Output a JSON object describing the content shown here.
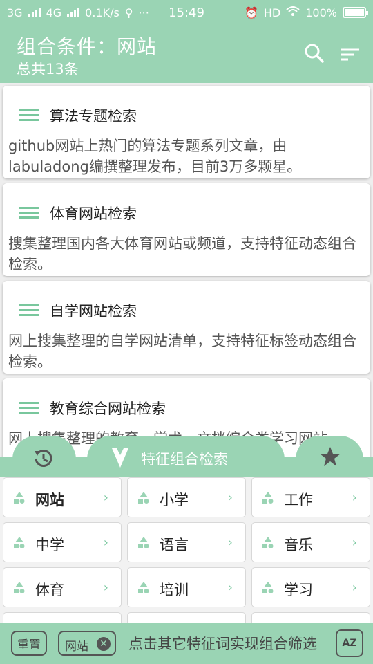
{
  "status_bar": {
    "net1": "3G",
    "net2": "4G",
    "speed": "0.1K/s",
    "time": "15:49",
    "hd": "HD",
    "battery": "100%"
  },
  "header": {
    "title": "组合条件：网站",
    "subtitle": "总共13条"
  },
  "cards": [
    {
      "title": "算法专题检索",
      "desc": "github网站上热门的算法专题系列文章，由labuladong编撰整理发布，目前3万多颗星。"
    },
    {
      "title": "体育网站检索",
      "desc": "搜集整理国内各大体育网站或频道，支持特征动态组合检索。"
    },
    {
      "title": "自学网站检索",
      "desc": "网上搜集整理的自学网站清单，支持特征标签动态组合检索。"
    },
    {
      "title": "教育综合网站检索",
      "desc": "网上搜集整理的教育、学术、文档综合类学习网站"
    }
  ],
  "tabs": {
    "main_label": "特征组合检索",
    "history_icon": "history-icon",
    "star_icon": "star-icon"
  },
  "chips": [
    {
      "label": "网站",
      "selected": true
    },
    {
      "label": "小学"
    },
    {
      "label": "工作"
    },
    {
      "label": "中学"
    },
    {
      "label": "语言"
    },
    {
      "label": "音乐"
    },
    {
      "label": "体育"
    },
    {
      "label": "培训"
    },
    {
      "label": "学习"
    }
  ],
  "bottom": {
    "reset": "重置",
    "tag": "网站",
    "hint": "点击其它特征词实现组合筛选",
    "sort": "AZ"
  },
  "colors": {
    "accent": "#9ad4b4",
    "accent_dark": "#79c79d"
  }
}
